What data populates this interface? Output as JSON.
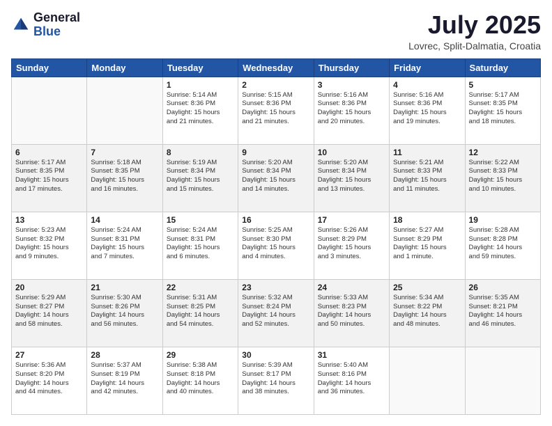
{
  "logo": {
    "general": "General",
    "blue": "Blue"
  },
  "header": {
    "month": "July 2025",
    "location": "Lovrec, Split-Dalmatia, Croatia"
  },
  "days_of_week": [
    "Sunday",
    "Monday",
    "Tuesday",
    "Wednesday",
    "Thursday",
    "Friday",
    "Saturday"
  ],
  "weeks": [
    [
      {
        "day": "",
        "content": ""
      },
      {
        "day": "",
        "content": ""
      },
      {
        "day": "1",
        "content": "Sunrise: 5:14 AM\nSunset: 8:36 PM\nDaylight: 15 hours\nand 21 minutes."
      },
      {
        "day": "2",
        "content": "Sunrise: 5:15 AM\nSunset: 8:36 PM\nDaylight: 15 hours\nand 21 minutes."
      },
      {
        "day": "3",
        "content": "Sunrise: 5:16 AM\nSunset: 8:36 PM\nDaylight: 15 hours\nand 20 minutes."
      },
      {
        "day": "4",
        "content": "Sunrise: 5:16 AM\nSunset: 8:36 PM\nDaylight: 15 hours\nand 19 minutes."
      },
      {
        "day": "5",
        "content": "Sunrise: 5:17 AM\nSunset: 8:35 PM\nDaylight: 15 hours\nand 18 minutes."
      }
    ],
    [
      {
        "day": "6",
        "content": "Sunrise: 5:17 AM\nSunset: 8:35 PM\nDaylight: 15 hours\nand 17 minutes."
      },
      {
        "day": "7",
        "content": "Sunrise: 5:18 AM\nSunset: 8:35 PM\nDaylight: 15 hours\nand 16 minutes."
      },
      {
        "day": "8",
        "content": "Sunrise: 5:19 AM\nSunset: 8:34 PM\nDaylight: 15 hours\nand 15 minutes."
      },
      {
        "day": "9",
        "content": "Sunrise: 5:20 AM\nSunset: 8:34 PM\nDaylight: 15 hours\nand 14 minutes."
      },
      {
        "day": "10",
        "content": "Sunrise: 5:20 AM\nSunset: 8:34 PM\nDaylight: 15 hours\nand 13 minutes."
      },
      {
        "day": "11",
        "content": "Sunrise: 5:21 AM\nSunset: 8:33 PM\nDaylight: 15 hours\nand 11 minutes."
      },
      {
        "day": "12",
        "content": "Sunrise: 5:22 AM\nSunset: 8:33 PM\nDaylight: 15 hours\nand 10 minutes."
      }
    ],
    [
      {
        "day": "13",
        "content": "Sunrise: 5:23 AM\nSunset: 8:32 PM\nDaylight: 15 hours\nand 9 minutes."
      },
      {
        "day": "14",
        "content": "Sunrise: 5:24 AM\nSunset: 8:31 PM\nDaylight: 15 hours\nand 7 minutes."
      },
      {
        "day": "15",
        "content": "Sunrise: 5:24 AM\nSunset: 8:31 PM\nDaylight: 15 hours\nand 6 minutes."
      },
      {
        "day": "16",
        "content": "Sunrise: 5:25 AM\nSunset: 8:30 PM\nDaylight: 15 hours\nand 4 minutes."
      },
      {
        "day": "17",
        "content": "Sunrise: 5:26 AM\nSunset: 8:29 PM\nDaylight: 15 hours\nand 3 minutes."
      },
      {
        "day": "18",
        "content": "Sunrise: 5:27 AM\nSunset: 8:29 PM\nDaylight: 15 hours\nand 1 minute."
      },
      {
        "day": "19",
        "content": "Sunrise: 5:28 AM\nSunset: 8:28 PM\nDaylight: 14 hours\nand 59 minutes."
      }
    ],
    [
      {
        "day": "20",
        "content": "Sunrise: 5:29 AM\nSunset: 8:27 PM\nDaylight: 14 hours\nand 58 minutes."
      },
      {
        "day": "21",
        "content": "Sunrise: 5:30 AM\nSunset: 8:26 PM\nDaylight: 14 hours\nand 56 minutes."
      },
      {
        "day": "22",
        "content": "Sunrise: 5:31 AM\nSunset: 8:25 PM\nDaylight: 14 hours\nand 54 minutes."
      },
      {
        "day": "23",
        "content": "Sunrise: 5:32 AM\nSunset: 8:24 PM\nDaylight: 14 hours\nand 52 minutes."
      },
      {
        "day": "24",
        "content": "Sunrise: 5:33 AM\nSunset: 8:23 PM\nDaylight: 14 hours\nand 50 minutes."
      },
      {
        "day": "25",
        "content": "Sunrise: 5:34 AM\nSunset: 8:22 PM\nDaylight: 14 hours\nand 48 minutes."
      },
      {
        "day": "26",
        "content": "Sunrise: 5:35 AM\nSunset: 8:21 PM\nDaylight: 14 hours\nand 46 minutes."
      }
    ],
    [
      {
        "day": "27",
        "content": "Sunrise: 5:36 AM\nSunset: 8:20 PM\nDaylight: 14 hours\nand 44 minutes."
      },
      {
        "day": "28",
        "content": "Sunrise: 5:37 AM\nSunset: 8:19 PM\nDaylight: 14 hours\nand 42 minutes."
      },
      {
        "day": "29",
        "content": "Sunrise: 5:38 AM\nSunset: 8:18 PM\nDaylight: 14 hours\nand 40 minutes."
      },
      {
        "day": "30",
        "content": "Sunrise: 5:39 AM\nSunset: 8:17 PM\nDaylight: 14 hours\nand 38 minutes."
      },
      {
        "day": "31",
        "content": "Sunrise: 5:40 AM\nSunset: 8:16 PM\nDaylight: 14 hours\nand 36 minutes."
      },
      {
        "day": "",
        "content": ""
      },
      {
        "day": "",
        "content": ""
      }
    ]
  ]
}
